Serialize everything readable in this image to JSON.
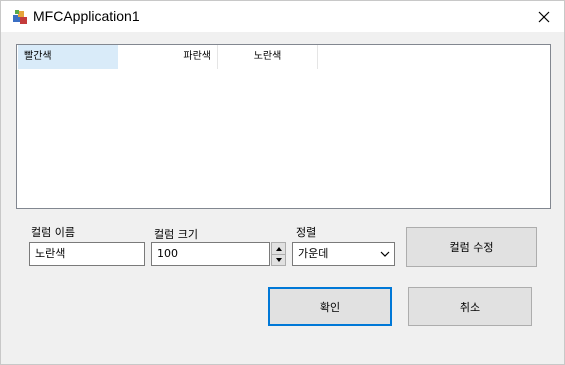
{
  "window": {
    "title": "MFCApplication1"
  },
  "list": {
    "columns": [
      "빨간색",
      "파란색",
      "노란색"
    ]
  },
  "form": {
    "column_name_label": "컬럼 이름",
    "column_name_value": "노란색",
    "column_size_label": "컬럼 크기",
    "column_size_value": "100",
    "align_label": "정렬",
    "align_value": "가운데",
    "modify_button": "컬럼 수정"
  },
  "buttons": {
    "ok": "확인",
    "cancel": "취소"
  },
  "icons": {
    "app": "mfc-app-icon",
    "close": "close-icon",
    "combo": "chevron-down-icon",
    "spin_up": "spin-up-icon",
    "spin_down": "spin-down-icon"
  },
  "colors": {
    "selected_header": "#d9ebf9",
    "default_button_border": "#0078d7"
  }
}
